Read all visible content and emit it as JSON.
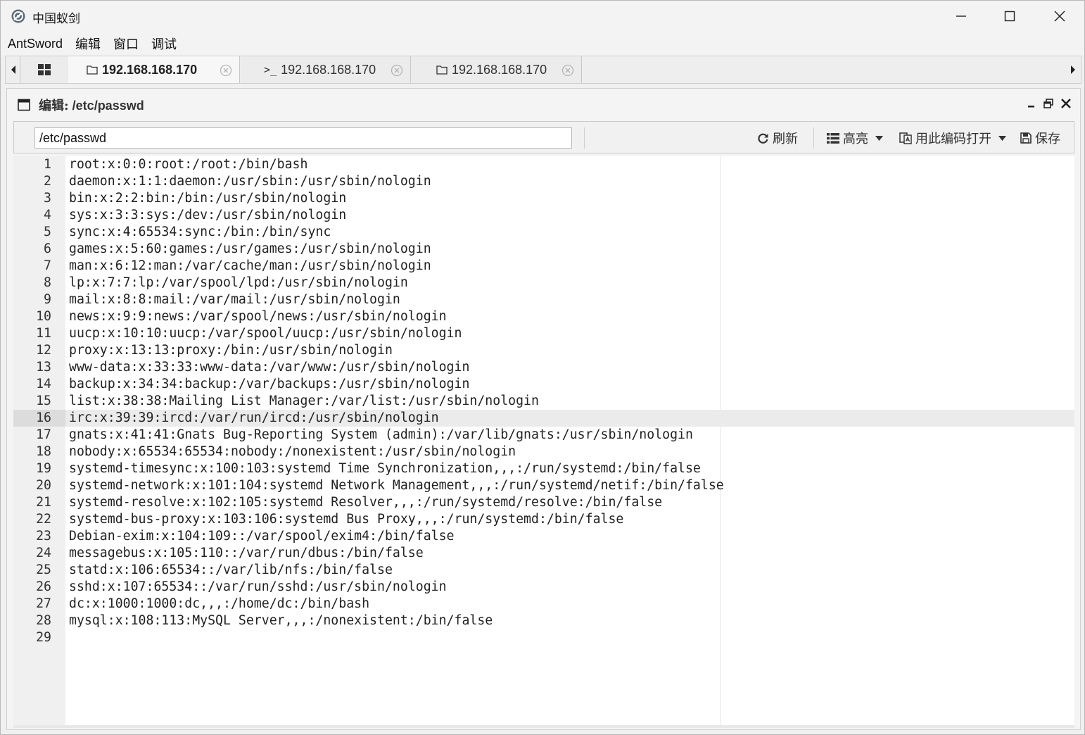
{
  "window": {
    "title": "中国蚁剑"
  },
  "menu": {
    "items": [
      {
        "key": "antsword",
        "label": "AntSword"
      },
      {
        "key": "edit",
        "label": "编辑"
      },
      {
        "key": "window",
        "label": "窗口"
      },
      {
        "key": "debug",
        "label": "调试"
      }
    ]
  },
  "tabs": [
    {
      "label": "192.168.168.170",
      "type": "folder",
      "active": true
    },
    {
      "label": "192.168.168.170",
      "type": "terminal",
      "active": false
    },
    {
      "label": "192.168.168.170",
      "type": "folder",
      "active": false
    }
  ],
  "panel": {
    "title_label": "编辑:",
    "title_path": "/etc/passwd"
  },
  "toolbar": {
    "path_value": "/etc/passwd",
    "refresh_label": "刷新",
    "highlight_label": "高亮",
    "encoding_label": "用此编码打开",
    "save_label": "保存"
  },
  "editor": {
    "active_line": 16,
    "lines": [
      "root:x:0:0:root:/root:/bin/bash",
      "daemon:x:1:1:daemon:/usr/sbin:/usr/sbin/nologin",
      "bin:x:2:2:bin:/bin:/usr/sbin/nologin",
      "sys:x:3:3:sys:/dev:/usr/sbin/nologin",
      "sync:x:4:65534:sync:/bin:/bin/sync",
      "games:x:5:60:games:/usr/games:/usr/sbin/nologin",
      "man:x:6:12:man:/var/cache/man:/usr/sbin/nologin",
      "lp:x:7:7:lp:/var/spool/lpd:/usr/sbin/nologin",
      "mail:x:8:8:mail:/var/mail:/usr/sbin/nologin",
      "news:x:9:9:news:/var/spool/news:/usr/sbin/nologin",
      "uucp:x:10:10:uucp:/var/spool/uucp:/usr/sbin/nologin",
      "proxy:x:13:13:proxy:/bin:/usr/sbin/nologin",
      "www-data:x:33:33:www-data:/var/www:/usr/sbin/nologin",
      "backup:x:34:34:backup:/var/backups:/usr/sbin/nologin",
      "list:x:38:38:Mailing List Manager:/var/list:/usr/sbin/nologin",
      "irc:x:39:39:ircd:/var/run/ircd:/usr/sbin/nologin",
      "gnats:x:41:41:Gnats Bug-Reporting System (admin):/var/lib/gnats:/usr/sbin/nologin",
      "nobody:x:65534:65534:nobody:/nonexistent:/usr/sbin/nologin",
      "systemd-timesync:x:100:103:systemd Time Synchronization,,,:/run/systemd:/bin/false",
      "systemd-network:x:101:104:systemd Network Management,,,:/run/systemd/netif:/bin/false",
      "systemd-resolve:x:102:105:systemd Resolver,,,:/run/systemd/resolve:/bin/false",
      "systemd-bus-proxy:x:103:106:systemd Bus Proxy,,,:/run/systemd:/bin/false",
      "Debian-exim:x:104:109::/var/spool/exim4:/bin/false",
      "messagebus:x:105:110::/var/run/dbus:/bin/false",
      "statd:x:106:65534::/var/lib/nfs:/bin/false",
      "sshd:x:107:65534::/var/run/sshd:/usr/sbin/nologin",
      "dc:x:1000:1000:dc,,,:/home/dc:/bin/bash",
      "mysql:x:108:113:MySQL Server,,,:/nonexistent:/bin/false",
      ""
    ]
  }
}
